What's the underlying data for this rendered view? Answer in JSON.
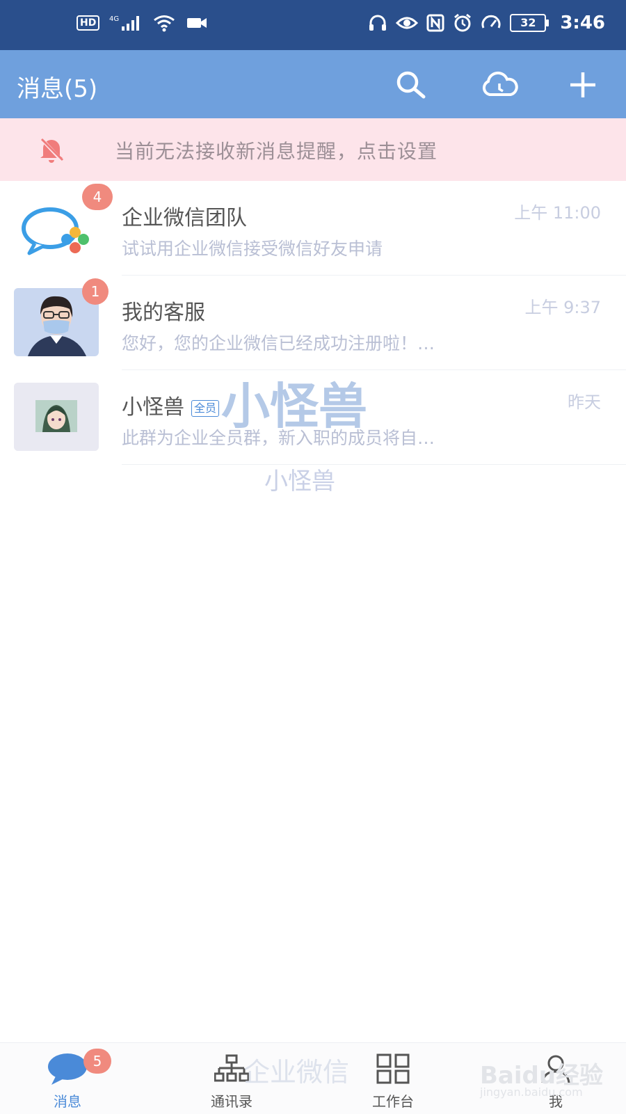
{
  "status_bar": {
    "hd": "HD",
    "network": "4G",
    "battery": "32",
    "time": "3:46"
  },
  "header": {
    "title": "消息(5)"
  },
  "notice": {
    "text": "当前无法接收新消息提醒，点击设置"
  },
  "conversations": [
    {
      "name": "企业微信团队",
      "time": "上午 11:00",
      "preview": "试试用企业微信接受微信好友申请",
      "badge": "4"
    },
    {
      "name": "我的客服",
      "time": "上午 9:37",
      "preview": "您好，您的企业微信已经成功注册啦！…",
      "badge": "1"
    },
    {
      "name": "小怪兽",
      "tag": "全员",
      "time": "昨天",
      "preview": "此群为企业全员群，新入职的成员将自…",
      "badge": ""
    }
  ],
  "watermarks": {
    "big": "小怪兽",
    "small": "小怪兽",
    "tab": "企业微信",
    "baidu": "Baidu经验",
    "baidu_sub": "jingyan.baidu.com"
  },
  "tabs": [
    {
      "label": "消息",
      "badge": "5"
    },
    {
      "label": "通讯录"
    },
    {
      "label": "工作台"
    },
    {
      "label": "我"
    }
  ],
  "colors": {
    "status_bar": "#2a4f8c",
    "app_bar": "#6fa0dd",
    "notice_bg": "#fde4ea",
    "badge": "#f08a7e",
    "accent": "#4a8ad8"
  }
}
